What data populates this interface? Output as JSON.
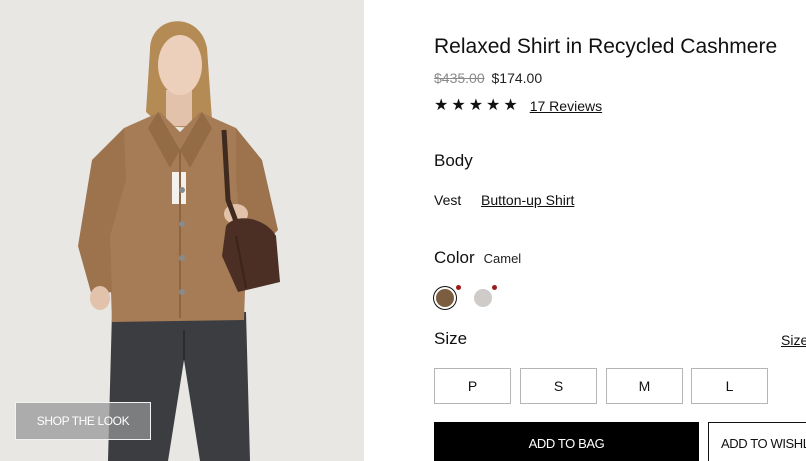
{
  "photo": {
    "cta_label": "SHOP THE LOOK"
  },
  "product": {
    "title": "Relaxed Shirt in Recycled Cashmere",
    "price_original": "$435.00",
    "price_sale": "$174.00",
    "rating": 5,
    "stars": [
      "★",
      "★",
      "★",
      "★",
      "★"
    ],
    "reviews_label": "17 Reviews"
  },
  "body": {
    "label": "Body",
    "options": [
      "Vest",
      "Button-up Shirt"
    ],
    "selected": "Vest"
  },
  "color": {
    "label": "Color",
    "selected": "Camel",
    "swatches": [
      {
        "name": "camel-swatch",
        "hex": "#7b5e3f"
      },
      {
        "name": "grey-swatch",
        "hex": "#cfcbc8"
      }
    ]
  },
  "size": {
    "label": "Size",
    "guide_label": "Size",
    "options": [
      "P",
      "S",
      "M",
      "L"
    ]
  },
  "actions": {
    "add_to_bag": "ADD TO BAG",
    "add_to_wishlist": "ADD TO WISHLIST"
  }
}
